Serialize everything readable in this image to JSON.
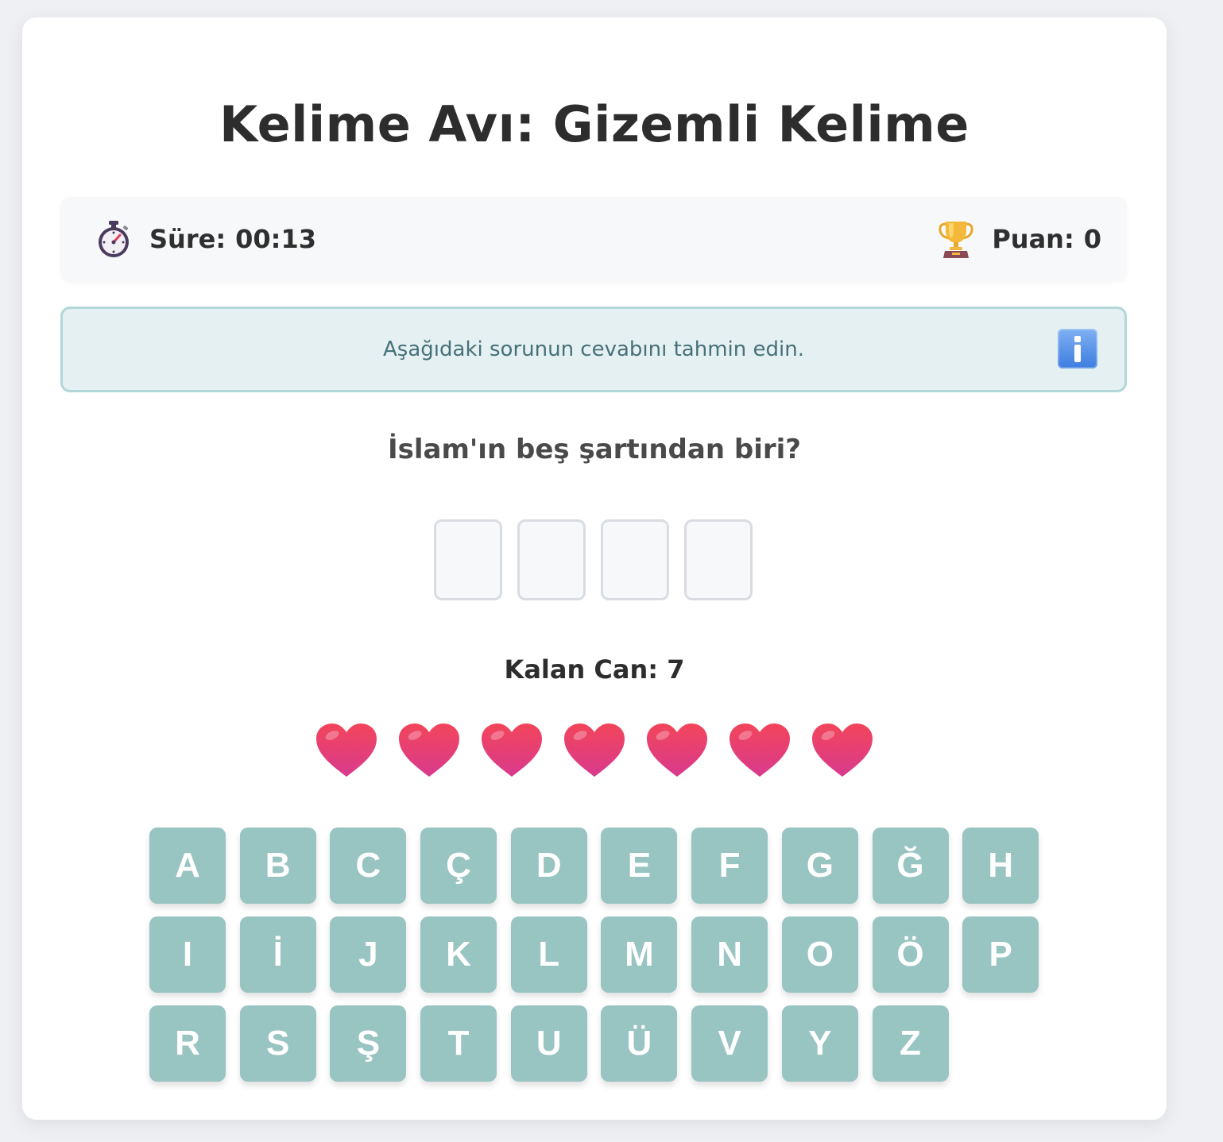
{
  "title": "Kelime Avı: Gizemli Kelime",
  "status": {
    "timer_icon": "stopwatch-icon",
    "timer_label": "Süre:",
    "timer_value": "00:13",
    "score_icon": "trophy-icon",
    "score_label": "Puan:",
    "score_value": "0"
  },
  "info": {
    "message": "Aşağıdaki sorunun cevabını tahmin edin.",
    "icon": "info-icon"
  },
  "question": "İslam'ın beş şartından biri?",
  "answer_slots": [
    "",
    "",
    "",
    ""
  ],
  "lives": {
    "label": "Kalan Can: 7",
    "count": 7,
    "icon": "heart-icon",
    "color": "#e8345a"
  },
  "keyboard": {
    "rows": [
      [
        "A",
        "B",
        "C",
        "Ç",
        "D",
        "E",
        "F",
        "G",
        "Ğ",
        "H"
      ],
      [
        "I",
        "İ",
        "J",
        "K",
        "L",
        "M",
        "N",
        "O",
        "Ö",
        "P"
      ],
      [
        "R",
        "S",
        "Ş",
        "T",
        "U",
        "Ü",
        "V",
        "Y",
        "Z"
      ]
    ],
    "key_color": "#98c4c1"
  }
}
